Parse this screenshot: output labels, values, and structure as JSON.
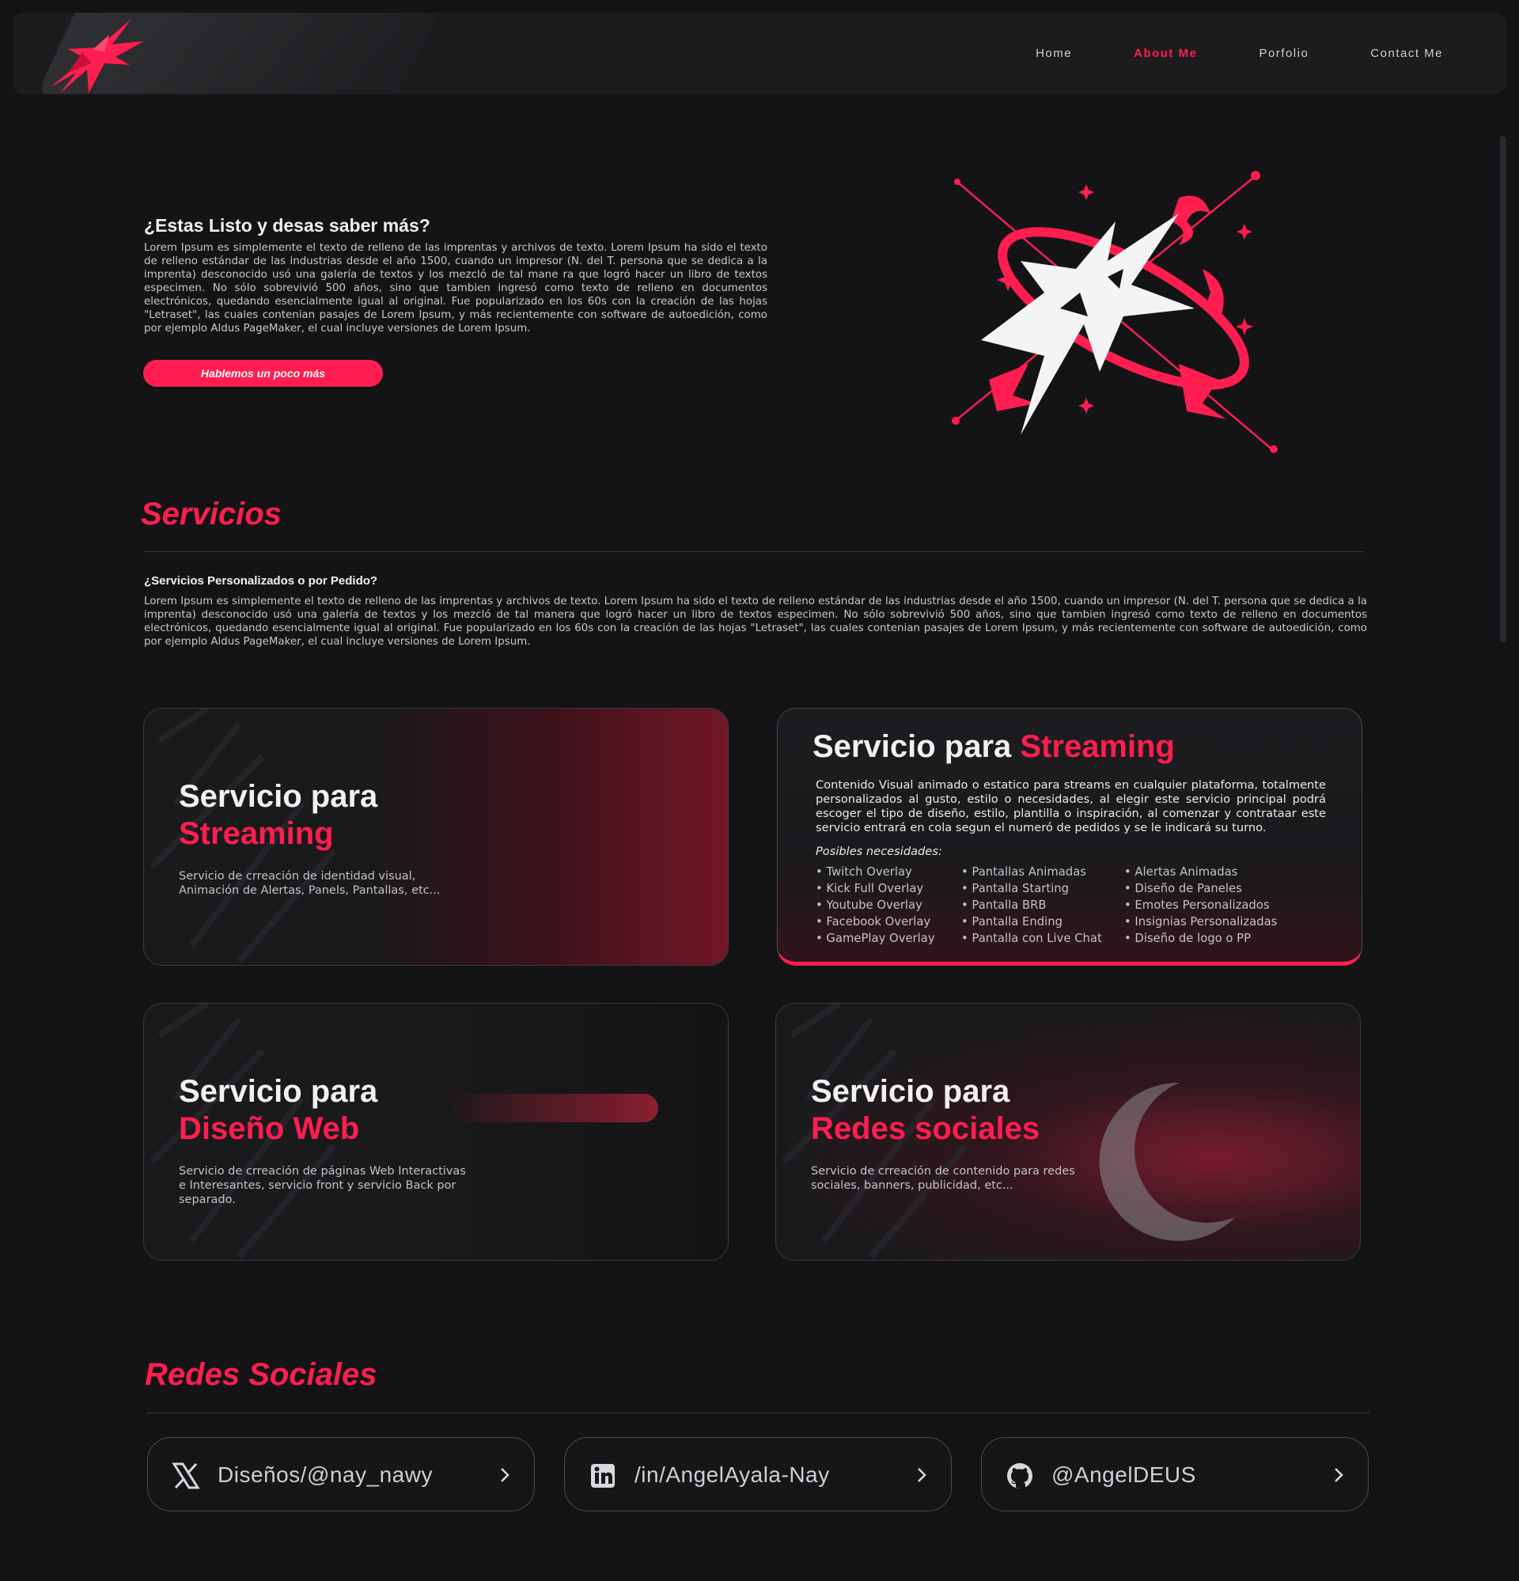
{
  "colors": {
    "accent": "#ff1e4f",
    "background": "#141416",
    "card": "#1a1a1d"
  },
  "nav": {
    "logo_icon": "brand-x-logo",
    "links": [
      {
        "label": "Home",
        "active": false
      },
      {
        "label": "About Me",
        "active": true
      },
      {
        "label": "Porfolio",
        "active": false
      },
      {
        "label": "Contact Me",
        "active": false
      }
    ]
  },
  "hero": {
    "title": "¿Estas Listo y desas saber más?",
    "text": "Lorem Ipsum es simplemente el texto de relleno de las imprentas y archivos de texto. Lorem Ipsum ha sido el texto de relleno estándar de las industrias desde el año 1500, cuando un impresor (N. del T. persona que se dedica a la imprenta) desconocido usó una galería de textos y los mezcló de tal mane ra que logró hacer un libro de textos especimen. No sólo sobrevivió 500 años, sino que tambien ingresó como texto de relleno en documentos electrónicos, quedando esencialmente igual al original. Fue popularizado en los 60s con la creación de las hojas \"Letraset\", las cuales contenian pasajes de Lorem Ipsum, y más recientemente con software de autoedición, como por ejemplo Aldus PageMaker, el cual incluye versiones de Lorem Ipsum.",
    "button_label": "Hablemos un poco más",
    "emblem_icon": "brand-emblem-large"
  },
  "services": {
    "title": "Servicios",
    "subtitle": "¿Servicios Personalizados o por Pedido?",
    "text": "Lorem Ipsum es simplemente el texto de relleno de las imprentas y archivos de texto. Lorem Ipsum ha sido el texto de relleno estándar de las industrias desde el año 1500, cuando un impresor (N. del T. persona que se dedica a la imprenta) desconocido usó una galería de textos y los mezcló de tal manera que logró hacer un libro de textos especimen. No sólo sobrevivió 500 años, sino que tambien ingresó como texto de relleno en documentos electrónicos, quedando esencialmente igual al original. Fue popularizado en los 60s con la creación de las hojas \"Letraset\", las cuales contenian pasajes de Lorem Ipsum, y más recientemente con software de autoedición, como por ejemplo Aldus PageMaker, el cual incluye versiones de Lorem Ipsum.",
    "cards": [
      {
        "title_line1": "Servicio para",
        "title_accent": "Streaming",
        "desc": "Servicio de crreación de identidad visual, Animación de Alertas, Panels, Pantallas, etc..."
      },
      {
        "title_prefix": "Servicio para ",
        "title_accent": "Streaming",
        "desc": "Contenido Visual animado o estatico para streams en cualquier plataforma, totalmente personalizados al gusto, estilo o necesidades, al elegir este servicio principal podrá escoger el tipo de diseño, estilo, plantilla o inspiración, al comenzar y contrataar este servicio entrará en cola segun el numeró de pedidos y se le indicará su turno.",
        "needs_label": "Posibles necesidades:",
        "needs_col1": [
          "• Twitch Overlay",
          "• Kick Full Overlay",
          "• Youtube Overlay",
          "• Facebook Overlay",
          "• GamePlay Overlay"
        ],
        "needs_col2": [
          "• Pantallas Animadas",
          "• Pantalla Starting",
          "• Pantalla BRB",
          "• Pantalla Ending",
          "• Pantalla con Live Chat"
        ],
        "needs_col3": [
          "• Alertas Animadas",
          "• Diseño de Paneles",
          "• Emotes Personalizados",
          "• Insignias Personalizadas",
          "• Diseño de logo o PP"
        ]
      },
      {
        "title_line1": "Servicio para",
        "title_accent": "Diseño Web",
        "desc": "Servicio de crreación de páginas Web Interactivas e Interesantes, servicio front y servicio Back por separado."
      },
      {
        "title_line1": "Servicio para",
        "title_accent": "Redes sociales",
        "desc": "Servicio de crreación de contenido para redes sociales, banners, publicidad, etc..."
      }
    ]
  },
  "social": {
    "title": "Redes Sociales",
    "items": [
      {
        "icon": "x-twitter-icon",
        "label": "Diseños/@nay_nawy"
      },
      {
        "icon": "linkedin-icon",
        "label": "/in/AngelAyala-Nay"
      },
      {
        "icon": "github-icon",
        "label": "@AngelDEUS"
      }
    ]
  }
}
